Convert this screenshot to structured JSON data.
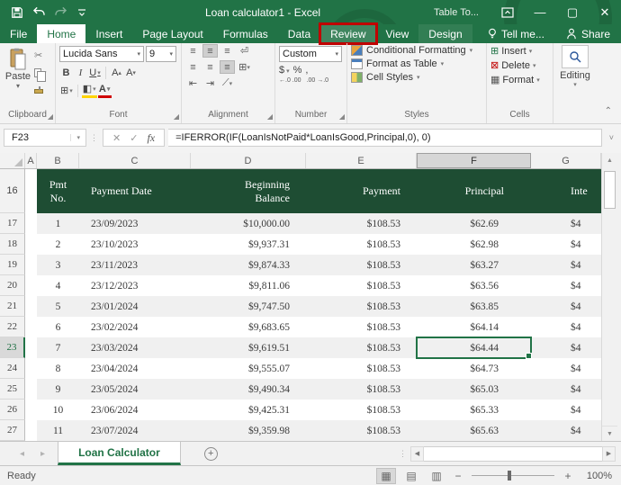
{
  "window": {
    "title": "Loan calculator1 - Excel",
    "contextual_tab_group": "Table To..."
  },
  "tabs": {
    "items": [
      "File",
      "Home",
      "Insert",
      "Page Layout",
      "Formulas",
      "Data",
      "Review",
      "View",
      "Design"
    ],
    "active": "Home",
    "highlighted": "Review",
    "tell_me": "Tell me...",
    "share": "Share"
  },
  "ribbon": {
    "clipboard": {
      "group_label": "Clipboard",
      "paste_label": "Paste"
    },
    "font": {
      "group_label": "Font",
      "font_name": "Lucida Sans",
      "font_size": "9",
      "bold": "B",
      "italic": "I",
      "underline": "U",
      "grow": "A",
      "shrink": "A",
      "borders": "⊞",
      "fill": "◧",
      "color": "A"
    },
    "alignment": {
      "group_label": "Alignment"
    },
    "number": {
      "group_label": "Number",
      "format": "Custom",
      "currency": "$",
      "percent": "%",
      "comma": ",",
      "inc_decimal": "←.0 .00",
      "dec_decimal": ".00 →.0"
    },
    "styles": {
      "group_label": "Styles",
      "conditional_formatting": "Conditional Formatting",
      "format_as_table": "Format as Table",
      "cell_styles": "Cell Styles"
    },
    "cells": {
      "group_label": "Cells",
      "insert": "Insert",
      "delete": "Delete",
      "format": "Format"
    },
    "editing": {
      "label": "Editing"
    }
  },
  "formula_bar": {
    "name_box": "F23",
    "formula": "=IFERROR(IF(LoanIsNotPaid*LoanIsGood,Principal,0), 0)"
  },
  "sheet": {
    "column_letters": [
      "A",
      "B",
      "C",
      "D",
      "E",
      "F",
      "G"
    ],
    "selected_column": "F",
    "selected_cell": "F23",
    "header_row": {
      "number": "16",
      "pmt_no": "Pmt No.",
      "payment_date": "Payment Date",
      "beginning_balance": "Beginning Balance",
      "payment": "Payment",
      "principal": "Principal",
      "interest_clipped": "Inte"
    },
    "rows": [
      {
        "n": "17",
        "pmt": "1",
        "date": "23/09/2023",
        "balance": "$10,000.00",
        "payment": "$108.53",
        "principal": "$62.69",
        "interest": "$4"
      },
      {
        "n": "18",
        "pmt": "2",
        "date": "23/10/2023",
        "balance": "$9,937.31",
        "payment": "$108.53",
        "principal": "$62.98",
        "interest": "$4"
      },
      {
        "n": "19",
        "pmt": "3",
        "date": "23/11/2023",
        "balance": "$9,874.33",
        "payment": "$108.53",
        "principal": "$63.27",
        "interest": "$4"
      },
      {
        "n": "20",
        "pmt": "4",
        "date": "23/12/2023",
        "balance": "$9,811.06",
        "payment": "$108.53",
        "principal": "$63.56",
        "interest": "$4"
      },
      {
        "n": "21",
        "pmt": "5",
        "date": "23/01/2024",
        "balance": "$9,747.50",
        "payment": "$108.53",
        "principal": "$63.85",
        "interest": "$4"
      },
      {
        "n": "22",
        "pmt": "6",
        "date": "23/02/2024",
        "balance": "$9,683.65",
        "payment": "$108.53",
        "principal": "$64.14",
        "interest": "$4"
      },
      {
        "n": "23",
        "pmt": "7",
        "date": "23/03/2024",
        "balance": "$9,619.51",
        "payment": "$108.53",
        "principal": "$64.44",
        "interest": "$4"
      },
      {
        "n": "24",
        "pmt": "8",
        "date": "23/04/2024",
        "balance": "$9,555.07",
        "payment": "$108.53",
        "principal": "$64.73",
        "interest": "$4"
      },
      {
        "n": "25",
        "pmt": "9",
        "date": "23/05/2024",
        "balance": "$9,490.34",
        "payment": "$108.53",
        "principal": "$65.03",
        "interest": "$4"
      },
      {
        "n": "26",
        "pmt": "10",
        "date": "23/06/2024",
        "balance": "$9,425.31",
        "payment": "$108.53",
        "principal": "$65.33",
        "interest": "$4"
      },
      {
        "n": "27",
        "pmt": "11",
        "date": "23/07/2024",
        "balance": "$9,359.98",
        "payment": "$108.53",
        "principal": "$65.63",
        "interest": "$4"
      }
    ]
  },
  "sheet_tabs": {
    "active_tab": "Loan Calculator"
  },
  "status_bar": {
    "status": "Ready",
    "zoom_level": "100%"
  },
  "colors": {
    "excel_green": "#217346",
    "table_header_green": "#1e4d33",
    "selection_green": "#217346",
    "annotation_red": "#c00000",
    "band_gray": "#f0f0f0"
  }
}
